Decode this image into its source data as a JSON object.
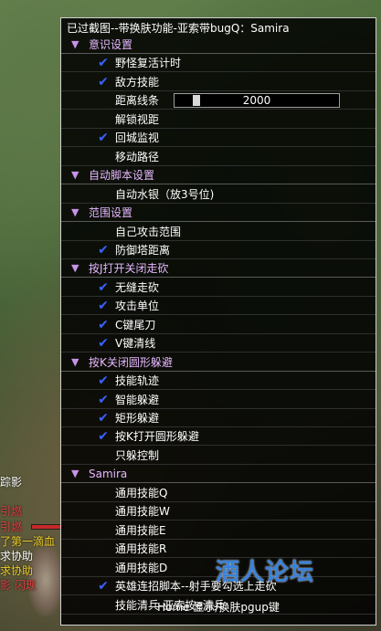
{
  "window": {
    "title": "已过截图--带换肤功能-亚索带bugQ：Samira",
    "footer": "Home 显示/换肤pgup键"
  },
  "watermark": "酒人论坛",
  "menu": [
    {
      "type": "section",
      "label": "意识设置"
    },
    {
      "type": "item",
      "label": "野怪复活计时",
      "checked": true
    },
    {
      "type": "item",
      "label": "敌方技能",
      "checked": true
    },
    {
      "type": "slider",
      "label": "距离线条",
      "value": "2000"
    },
    {
      "type": "item",
      "label": "解锁视距",
      "checked": false
    },
    {
      "type": "item",
      "label": "回城监视",
      "checked": true
    },
    {
      "type": "item",
      "label": "移动路径",
      "checked": false
    },
    {
      "type": "section",
      "label": "自动脚本设置"
    },
    {
      "type": "item",
      "label": "自动水银（放3号位)",
      "checked": false
    },
    {
      "type": "section",
      "label": "范围设置"
    },
    {
      "type": "item",
      "label": "自己攻击范围",
      "checked": false
    },
    {
      "type": "item",
      "label": "防御塔距离",
      "checked": true
    },
    {
      "type": "section",
      "label": "按J打开关闭走砍"
    },
    {
      "type": "item",
      "label": "无缝走砍",
      "checked": true
    },
    {
      "type": "item",
      "label": "攻击单位",
      "checked": true
    },
    {
      "type": "item",
      "label": "C键尾刀",
      "checked": true
    },
    {
      "type": "item",
      "label": "V键清线",
      "checked": true
    },
    {
      "type": "section",
      "label": "按K关闭圆形躲避"
    },
    {
      "type": "item",
      "label": "技能轨迹",
      "checked": true
    },
    {
      "type": "item",
      "label": "智能躲避",
      "checked": true
    },
    {
      "type": "item",
      "label": "矩形躲避",
      "checked": true
    },
    {
      "type": "item",
      "label": "按K打开圆形躲避",
      "checked": true
    },
    {
      "type": "item",
      "label": "只躲控制",
      "checked": false
    },
    {
      "type": "section",
      "label": "Samira"
    },
    {
      "type": "item",
      "label": "通用技能Q",
      "checked": false
    },
    {
      "type": "item",
      "label": "通用技能W",
      "checked": false
    },
    {
      "type": "item",
      "label": "通用技能E",
      "checked": false
    },
    {
      "type": "item",
      "label": "通用技能R",
      "checked": false
    },
    {
      "type": "item",
      "label": "通用技能D",
      "checked": false
    },
    {
      "type": "item",
      "label": "英雄连招脚本--射手要勾选上走砍",
      "checked": true
    },
    {
      "type": "item",
      "label": "技能清兵-亚索按e清兵",
      "checked": false
    }
  ],
  "background_chat": [
    {
      "text": "踪影",
      "color": "white"
    },
    {
      "text": "引燃",
      "color": "red"
    },
    {
      "text": "引燃",
      "color": "red"
    },
    {
      "text": "了第一滴血",
      "color": "yellow"
    },
    {
      "text": "求协助",
      "color": "white"
    },
    {
      "text": "求协助",
      "color": "yellow"
    },
    {
      "text": "影 闪现",
      "color": "red"
    }
  ],
  "icons": {
    "check": "check-icon",
    "section": "triangle-down-icon"
  },
  "colors": {
    "check": "#3b62ff",
    "section": "#e6b8ff",
    "arrow": "#c792e8"
  }
}
